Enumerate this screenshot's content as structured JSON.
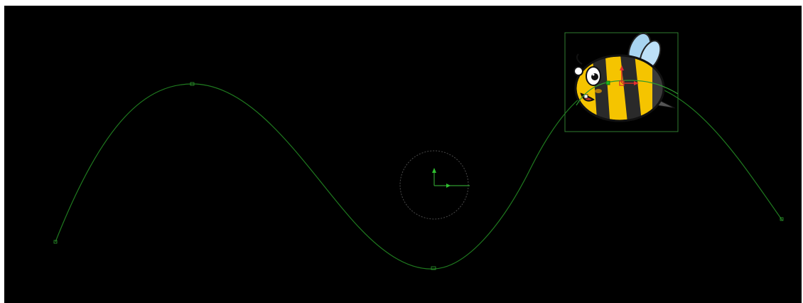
{
  "viewer": {
    "background_color": "#000000",
    "path_color": "#1f7a1f",
    "selection_color": "#2f7d2f",
    "gizmo_x_color": "#d42a2a",
    "gizmo_y_color": "#d42a2a",
    "gizmo_center_color": "#22b622",
    "guide_circle_color": "#3a3a3a"
  },
  "motion_path": {
    "keyframe_count": 6
  },
  "object": {
    "name_icon": "bee-icon"
  }
}
